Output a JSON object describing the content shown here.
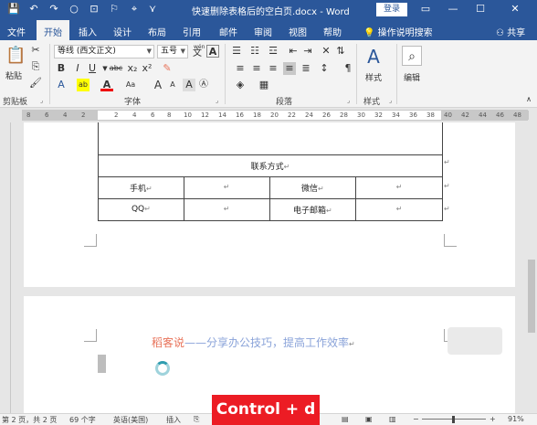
{
  "window": {
    "title": "快速删除表格后的空白页.docx - Word",
    "login": "登录",
    "controls": {
      "minimize": "—",
      "maximize": "☐",
      "close": "✕"
    }
  },
  "quick_access": [
    "💾",
    "↶",
    "↷",
    "○",
    "⊡",
    "⚐",
    "⌖",
    "⋎"
  ],
  "tabs": [
    "文件",
    "开始",
    "插入",
    "设计",
    "布局",
    "引用",
    "邮件",
    "审阅",
    "视图",
    "帮助"
  ],
  "active_tab": "开始",
  "tell_me": "操作说明搜索",
  "share": "共享",
  "ribbon": {
    "clipboard": {
      "paste": "粘贴",
      "label": "剪贴板"
    },
    "font": {
      "name": "等线 (西文正文)",
      "size": "五号",
      "wen": "wén",
      "label": "字体",
      "row2": [
        "B",
        "I",
        "U",
        "abc",
        "x₂",
        "x²"
      ],
      "row3": [
        "A",
        "ab",
        "A",
        "Aa",
        "A",
        "A",
        "A",
        "Ⓐ"
      ],
      "grow": "A",
      "shrink": "A",
      "case": "Aa",
      "clear": "A",
      "char": "A"
    },
    "paragraph": {
      "label": "段落"
    },
    "styles": {
      "button": "样式",
      "label": "样式"
    },
    "editing": {
      "button": "编辑"
    }
  },
  "ruler": {
    "numbers": [
      "8",
      "6",
      "4",
      "2",
      "2",
      "4",
      "6",
      "8",
      "10",
      "12",
      "14",
      "16",
      "18",
      "20",
      "22",
      "24",
      "26",
      "28",
      "30",
      "32",
      "34",
      "36",
      "38",
      "40",
      "42",
      "44",
      "46",
      "48"
    ]
  },
  "table": {
    "header": "联系方式",
    "rows": [
      [
        "手机",
        "",
        "微信",
        ""
      ],
      [
        "QQ",
        "",
        "电子邮箱",
        ""
      ]
    ],
    "mark": "↵"
  },
  "slogan": {
    "brand": "稻客说",
    "text": "——分享办公技巧，提高工作效率",
    "mark": "↵"
  },
  "overlay": "Control + d",
  "status": {
    "page": "第 2 页，共 2 页",
    "words": "69 个字",
    "lang": "英语(美国)",
    "insert": "插入",
    "zoom": "91%"
  }
}
